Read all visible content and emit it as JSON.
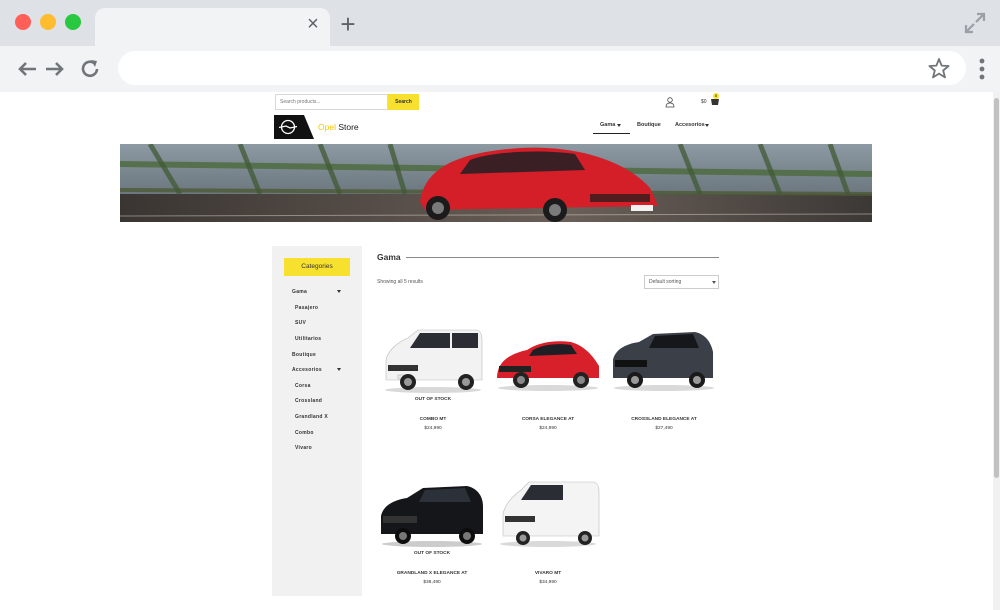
{
  "browser": {
    "tab_close_glyph": "×",
    "new_tab_glyph": "+",
    "address": ""
  },
  "topbar": {
    "search_placeholder": "Search products...",
    "search_button": "Search",
    "cart_amount": "$0",
    "cart_count": "0"
  },
  "header": {
    "brand_accent": "Opel",
    "brand_rest": " Store",
    "nav": [
      {
        "label": "Gama",
        "dropdown": true
      },
      {
        "label": "Boutique",
        "dropdown": false
      },
      {
        "label": "Accesorios",
        "dropdown": true
      }
    ]
  },
  "sidebar": {
    "heading": "Categories",
    "items": [
      {
        "label": "Gama",
        "level": 0,
        "caret": true
      },
      {
        "label": "Pasajero",
        "level": 1
      },
      {
        "label": "SUV",
        "level": 1
      },
      {
        "label": "Utilitarios",
        "level": 1
      },
      {
        "label": "Boutique",
        "level": 0
      },
      {
        "label": "Accesorios",
        "level": 0,
        "caret": true
      },
      {
        "label": "Corsa",
        "level": 1
      },
      {
        "label": "Crossland",
        "level": 1
      },
      {
        "label": "Grandland X",
        "level": 1
      },
      {
        "label": "Combo",
        "level": 1
      },
      {
        "label": "Vivaro",
        "level": 1
      }
    ]
  },
  "main": {
    "title": "Gama",
    "results_text": "Showing all 5 results",
    "sort_value": "Default sorting",
    "products": [
      {
        "name": "COMBO MT",
        "price": "$24,990",
        "badge": "OUT OF STOCK",
        "color": "#f2f2f2"
      },
      {
        "name": "CORSA ELEGANCE AT",
        "price": "$24,990",
        "badge": "",
        "color": "#d8202a"
      },
      {
        "name": "CROSSLAND ELEGANCE AT",
        "price": "$27,490",
        "badge": "",
        "color": "#3a3f48"
      },
      {
        "name": "GRANDLAND X ELEGANCE AT",
        "price": "$38,490",
        "badge": "OUT OF STOCK",
        "color": "#15161a"
      },
      {
        "name": "VIVARO MT",
        "price": "$34,990",
        "badge": "",
        "color": "#f4f4f4"
      }
    ]
  },
  "colors": {
    "accent": "#f7e12e",
    "sidebar_bg": "#f1f1f1",
    "text": "#333333"
  }
}
